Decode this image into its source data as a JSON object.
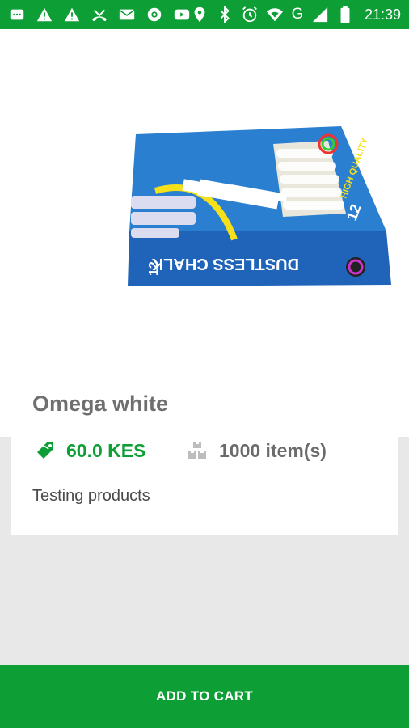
{
  "status_bar": {
    "time": "21:39",
    "icons": [
      "message-icon",
      "warning-icon",
      "warning-icon",
      "missed-call-icon",
      "mail-icon",
      "camera-icon",
      "youtube-icon",
      "location-icon",
      "bluetooth-icon",
      "alarm-icon",
      "wifi-icon",
      "signal-icon",
      "battery-icon"
    ],
    "network_type": "G"
  },
  "product": {
    "title": "Omega white",
    "price": "60.0 KES",
    "stock": "1000 item(s)",
    "description": "Testing products",
    "image_icon": "chalk-box-image"
  },
  "actions": {
    "add_to_cart_label": "ADD TO CART"
  },
  "colors": {
    "accent": "#0d9f35",
    "background": "#e8e8e8",
    "card": "#ffffff",
    "title_text": "#6f6f6f",
    "stock_text": "#6b6b6b"
  }
}
